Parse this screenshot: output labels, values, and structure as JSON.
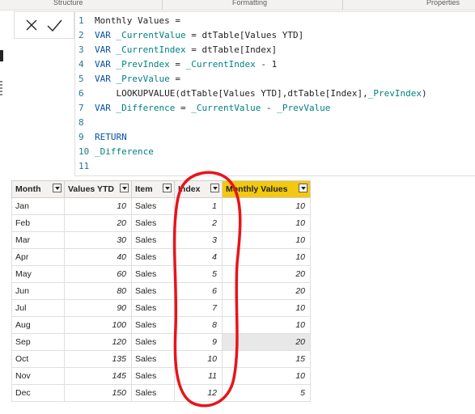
{
  "ribbon": {
    "structure": "Structure",
    "formatting": "Formatting",
    "properties": "Properties"
  },
  "formula_bar": {
    "cancel_icon": "close-icon",
    "commit_icon": "check-icon",
    "lines": [
      {
        "n": "1",
        "parts": [
          {
            "c": "txt",
            "t": "Monthly Values ="
          }
        ]
      },
      {
        "n": "2",
        "parts": [
          {
            "c": "kw",
            "t": "VAR "
          },
          {
            "c": "var",
            "t": "_CurrentValue"
          },
          {
            "c": "txt",
            "t": " = dtTable[Values YTD]"
          }
        ]
      },
      {
        "n": "3",
        "parts": [
          {
            "c": "kw",
            "t": "VAR "
          },
          {
            "c": "var",
            "t": "_CurrentIndex"
          },
          {
            "c": "txt",
            "t": " = dtTable[Index]"
          }
        ]
      },
      {
        "n": "4",
        "parts": [
          {
            "c": "kw",
            "t": "VAR "
          },
          {
            "c": "var",
            "t": "_PrevIndex"
          },
          {
            "c": "txt",
            "t": " = "
          },
          {
            "c": "var",
            "t": "_CurrentIndex"
          },
          {
            "c": "txt",
            "t": " - 1"
          }
        ]
      },
      {
        "n": "5",
        "parts": [
          {
            "c": "kw",
            "t": "VAR "
          },
          {
            "c": "var",
            "t": "_PrevValue"
          },
          {
            "c": "txt",
            "t": " ="
          }
        ]
      },
      {
        "n": "6",
        "parts": [
          {
            "c": "txt",
            "t": "    LOOKUPVALUE(dtTable[Values YTD],dtTable[Index],"
          },
          {
            "c": "var",
            "t": "_PrevIndex"
          },
          {
            "c": "txt",
            "t": ")"
          }
        ]
      },
      {
        "n": "7",
        "parts": [
          {
            "c": "kw",
            "t": "VAR "
          },
          {
            "c": "var",
            "t": "_Difference"
          },
          {
            "c": "txt",
            "t": " = "
          },
          {
            "c": "var",
            "t": "_CurrentValue"
          },
          {
            "c": "txt",
            "t": " - "
          },
          {
            "c": "var",
            "t": "_PrevValue"
          }
        ]
      },
      {
        "n": "8",
        "parts": []
      },
      {
        "n": "9",
        "parts": [
          {
            "c": "ctl",
            "t": "RETURN"
          }
        ]
      },
      {
        "n": "10",
        "parts": [
          {
            "c": "var",
            "t": "_Difference"
          }
        ]
      },
      {
        "n": "11",
        "parts": []
      }
    ]
  },
  "table": {
    "columns": [
      "Month",
      "Values YTD",
      "Item",
      "Index",
      "Monthly Values"
    ],
    "highlight_color": "#f2c811",
    "annotation_color": "#e8141c",
    "rows": [
      [
        "Jan",
        "10",
        "Sales",
        "1",
        "10"
      ],
      [
        "Feb",
        "20",
        "Sales",
        "2",
        "10"
      ],
      [
        "Mar",
        "30",
        "Sales",
        "3",
        "10"
      ],
      [
        "Apr",
        "40",
        "Sales",
        "4",
        "10"
      ],
      [
        "May",
        "60",
        "Sales",
        "5",
        "20"
      ],
      [
        "Jun",
        "80",
        "Sales",
        "6",
        "20"
      ],
      [
        "Jul",
        "90",
        "Sales",
        "7",
        "10"
      ],
      [
        "Aug",
        "100",
        "Sales",
        "8",
        "10"
      ],
      [
        "Sep",
        "120",
        "Sales",
        "9",
        "20"
      ],
      [
        "Oct",
        "135",
        "Sales",
        "10",
        "15"
      ],
      [
        "Nov",
        "145",
        "Sales",
        "11",
        "10"
      ],
      [
        "Dec",
        "150",
        "Sales",
        "12",
        "5"
      ]
    ]
  }
}
